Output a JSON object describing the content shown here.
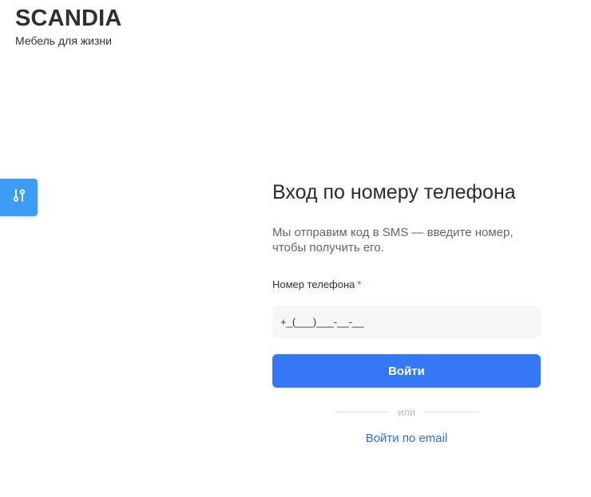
{
  "brand": {
    "title": "SCANDIA",
    "tagline": "Мебель для жизни"
  },
  "side_tab": {
    "icon": "sliders-icon",
    "color": "#3d9df5"
  },
  "login_form": {
    "title": "Вход по номеру телефона",
    "description": "Мы отправим код в SMS — введите номер, чтобы получить его.",
    "phone_label": "Номер телефона",
    "required_mark": "*",
    "phone_value": "+_(___)___-__-__",
    "submit_label": "Войти",
    "divider_text": "или",
    "email_link_label": "Войти по email"
  },
  "colors": {
    "accent": "#3478f6",
    "link": "#2f6fe4",
    "required": "#e53935"
  }
}
